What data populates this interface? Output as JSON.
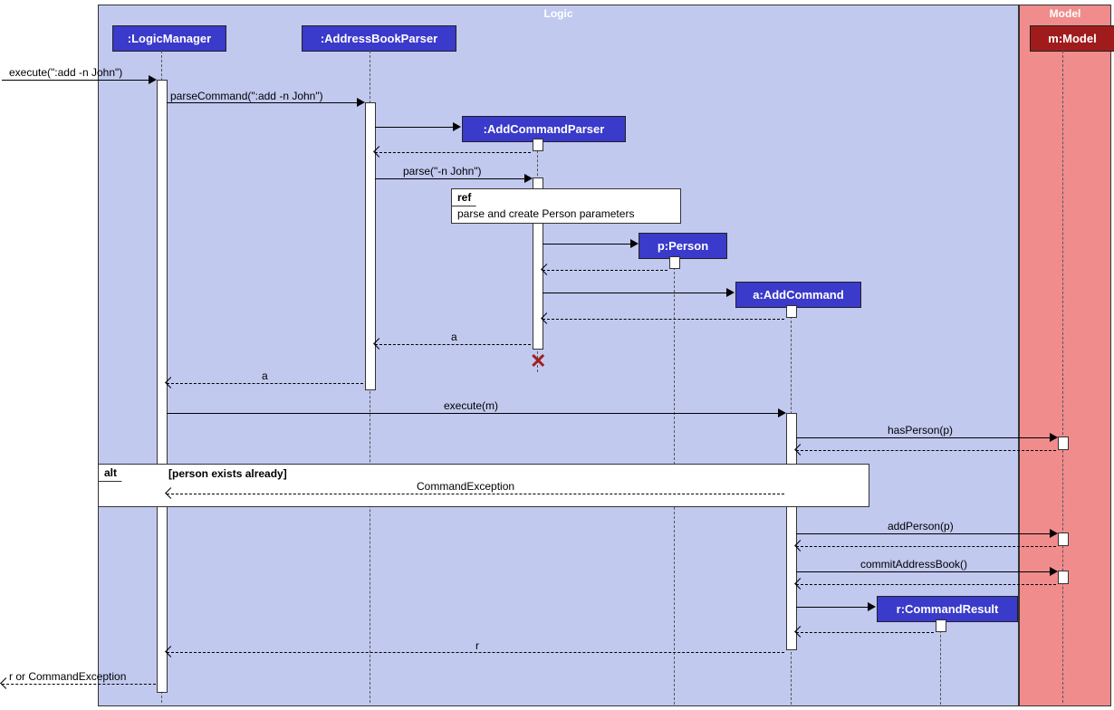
{
  "frames": {
    "logic": "Logic",
    "model": "Model"
  },
  "participants": {
    "logicManager": ":LogicManager",
    "addressBookParser": ":AddressBookParser",
    "addCommandParser": ":AddCommandParser",
    "person": "p:Person",
    "addCommand": "a:AddCommand",
    "commandResult": "r:CommandResult",
    "model": "m:Model"
  },
  "messages": {
    "executeAdd": "execute(\":add -n John\")",
    "parseCommand": "parseCommand(\":add -n John\")",
    "parse": "parse(\"-n John\")",
    "returnA1": "a",
    "returnA2": "a",
    "executeM": "execute(m)",
    "hasPerson": "hasPerson(p)",
    "commandException": "CommandException",
    "addPerson": "addPerson(p)",
    "commitAB": "commitAddressBook()",
    "returnR": "r",
    "returnFinal": "r or CommandException"
  },
  "boxes": {
    "refLabel": "ref",
    "refText": "parse and create Person parameters",
    "altLabel": "alt",
    "altGuard": "[person exists already]"
  }
}
